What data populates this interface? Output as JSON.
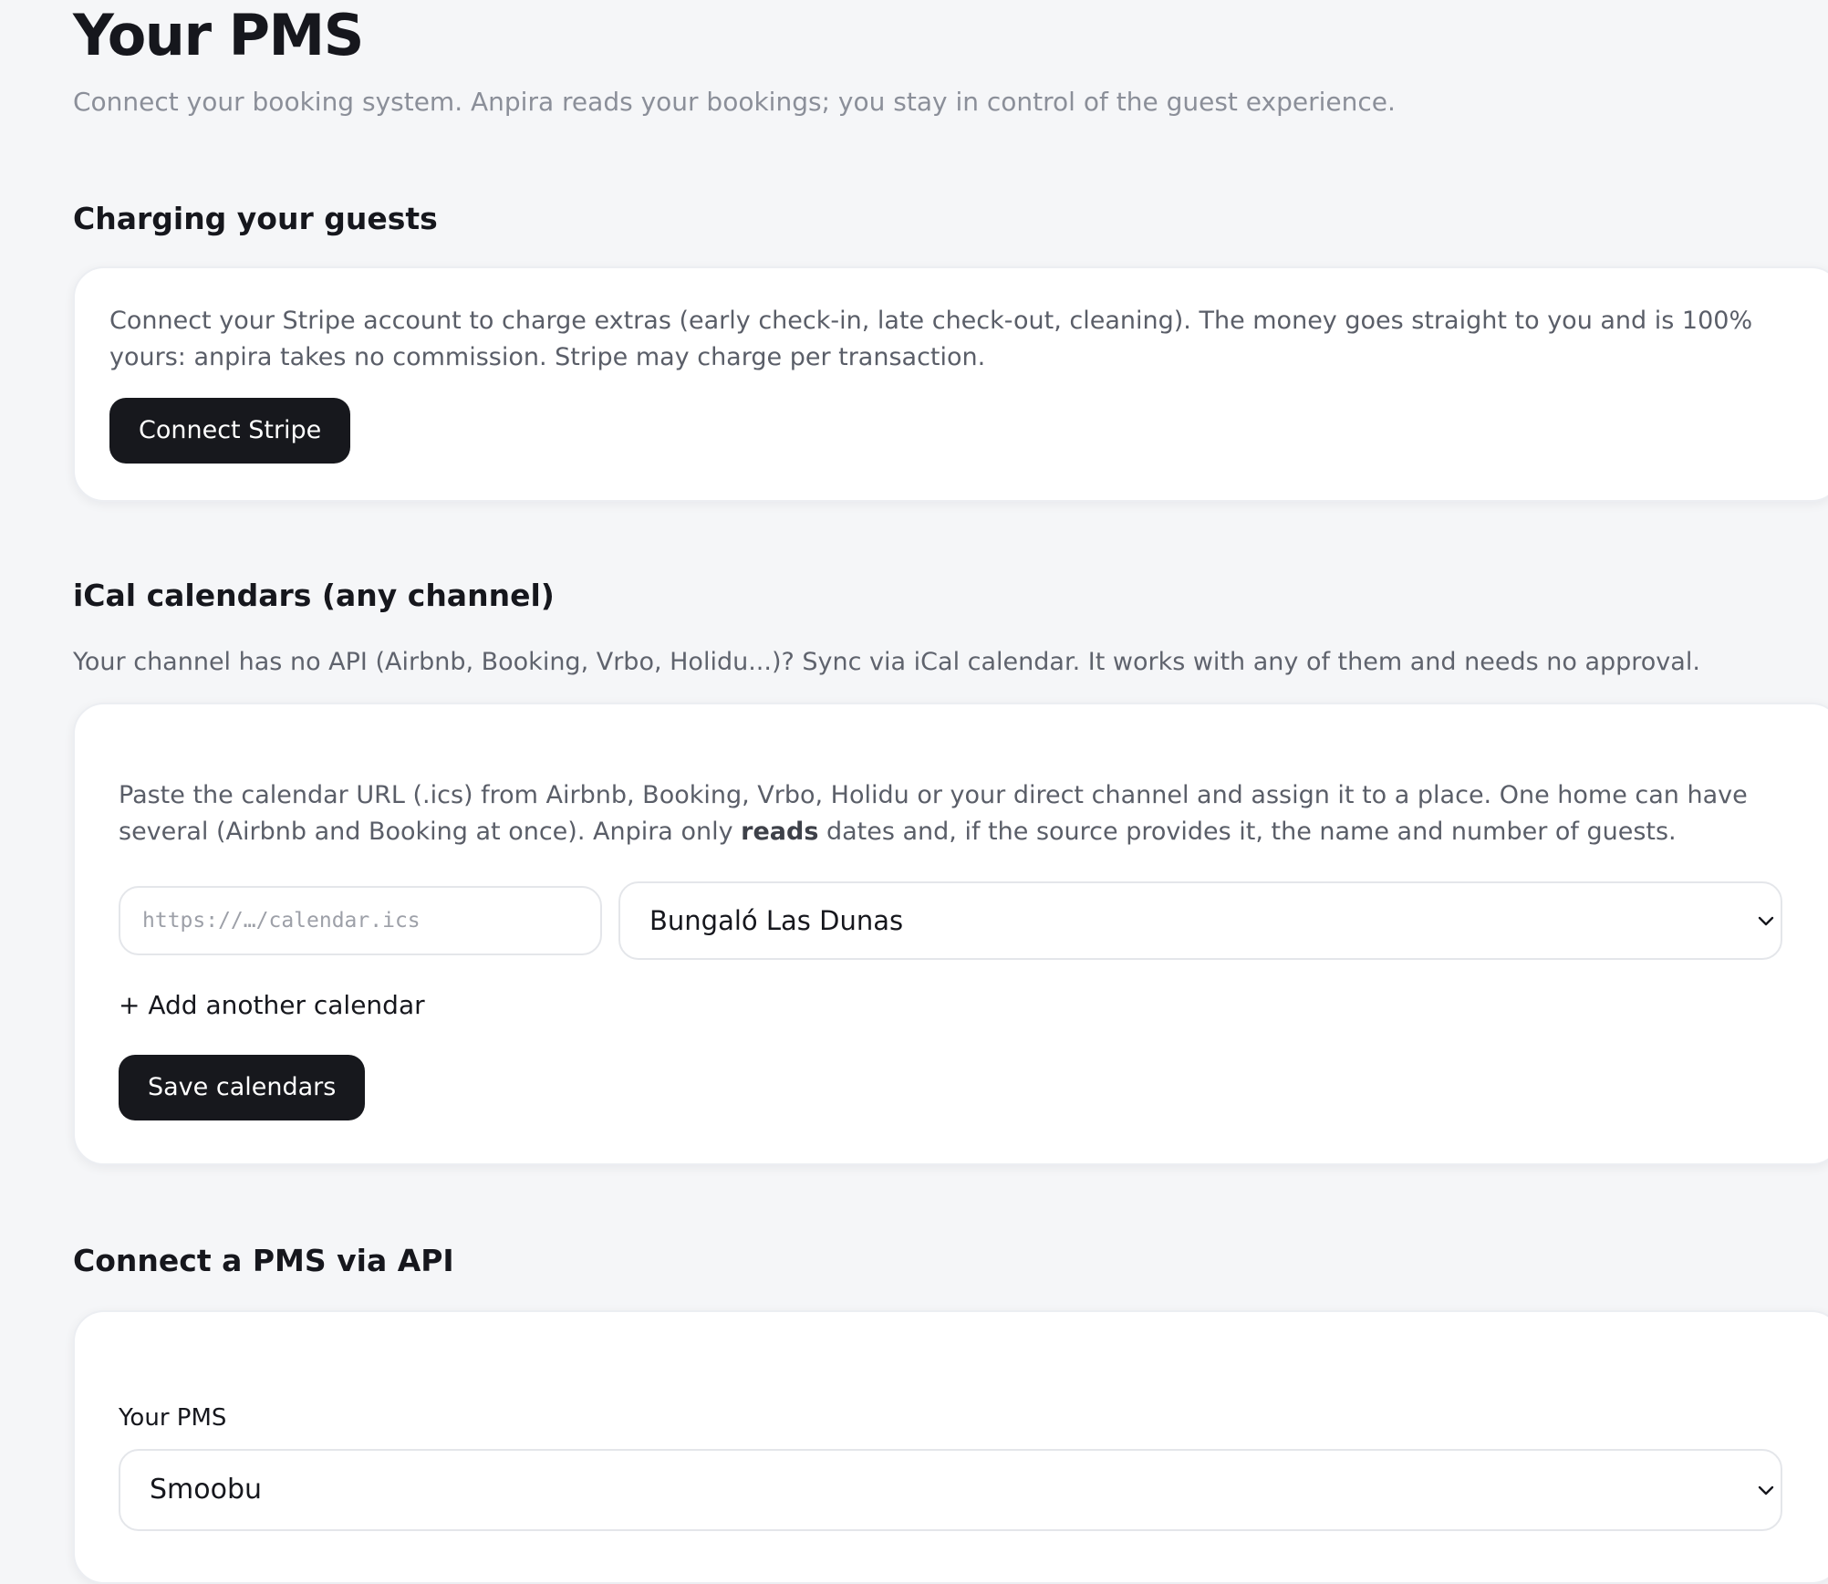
{
  "header": {
    "title": "Your PMS",
    "subtitle": "Connect your booking system. Anpira reads your bookings; you stay in control of the guest experience."
  },
  "stripe_section": {
    "title": "Charging your guests",
    "description": "Connect your Stripe account to charge extras (early check-in, late check-out, cleaning). The money goes straight to you and is 100% yours: anpira takes no commission. Stripe may charge per transaction.",
    "button_label": "Connect Stripe"
  },
  "ical_section": {
    "title": "iCal calendars (any channel)",
    "description": "Your channel has no API (Airbnb, Booking, Vrbo, Holidu...)? Sync via iCal calendar. It works with any of them and needs no approval.",
    "card_text_before": "Paste the calendar URL (.ics) from Airbnb, Booking, Vrbo, Holidu or your direct channel and assign it to a place. One home can have several (Airbnb and Booking at once). Anpira only ",
    "card_text_bold": "reads",
    "card_text_after": " dates and, if the source provides it, the name and number of guests.",
    "url_input": {
      "value": "",
      "placeholder": "https://…/calendar.ics"
    },
    "place_select": {
      "selected": "Bungaló Las Dunas"
    },
    "add_calendar_label": "+ Add another calendar",
    "save_button_label": "Save calendars"
  },
  "api_section": {
    "title": "Connect a PMS via API",
    "field_label": "Your PMS",
    "pms_select": {
      "selected": "Smoobu"
    }
  },
  "icons": {
    "select_chevron": "chevron-down-icon"
  },
  "colors": {
    "background": "#f5f6f8",
    "card": "#ffffff",
    "primary_button": "#17181d",
    "muted_text": "#8b8f99"
  }
}
